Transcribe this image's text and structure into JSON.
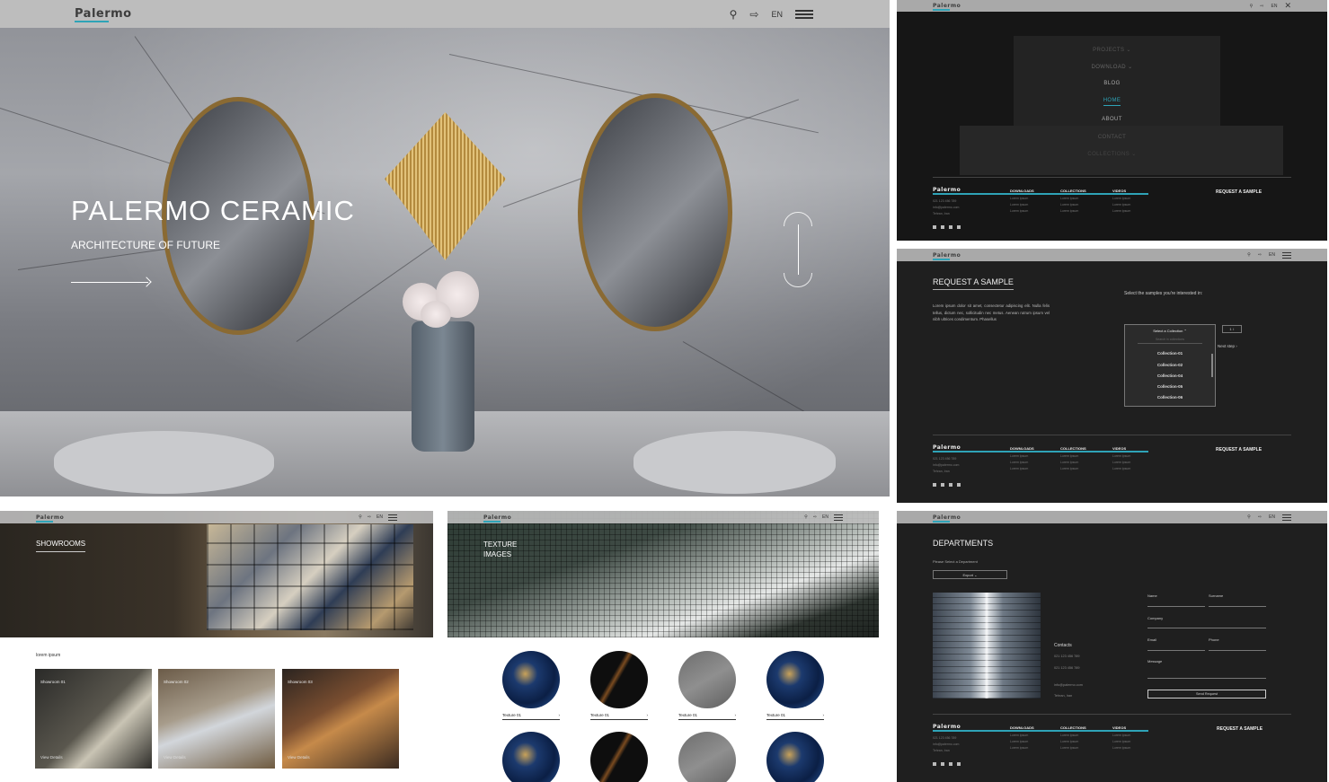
{
  "brand": {
    "logo": "Palermo",
    "accent": "#2ea3b7"
  },
  "hero": {
    "lang": "EN",
    "title": "PALERMO CERAMIC",
    "subtitle": "ARCHITECTURE OF FUTURE"
  },
  "menu": {
    "lang": "EN",
    "items": [
      "PROJECTS",
      "DOWNLOAD",
      "BLOG",
      "HOME",
      "ABOUT",
      "CONTACT",
      "COLLECTIONS"
    ],
    "active": "HOME"
  },
  "footer": {
    "logo": "Palermo",
    "contact": [
      "021 123 456 789",
      "info@palermo.com",
      "Tehran, Iran"
    ],
    "col1": {
      "title": "DOWNLOADS",
      "links": [
        "Lorem ipsum",
        "Lorem ipsum",
        "Lorem ipsum"
      ]
    },
    "col2": {
      "title": "COLLECTIONS",
      "links": [
        "Lorem ipsum",
        "Lorem ipsum",
        "Lorem ipsum"
      ]
    },
    "col3": {
      "title": "VIDEOS",
      "links": [
        "Lorem ipsum",
        "Lorem ipsum",
        "Lorem ipsum"
      ]
    },
    "cta": "REQUEST A SAMPLE"
  },
  "sample": {
    "lang": "EN",
    "title": "REQUEST A SAMPLE",
    "body": "Lorem ipsum dolor sit amet, consectetur adipiscing elit. Nulla felis tellus, dictum nec, sollicitudin nec metus. Aenean rutrum ipsum vel nibh ultrices condimentum. Phasellus",
    "prompt": "Select the samples you're interested in:",
    "dropdown_label": "Select a Collection",
    "search_placeholder": "Search in collections",
    "options": [
      "Collection-01",
      "Collection-02",
      "Collection-04",
      "Collection-05",
      "Collection-06"
    ],
    "qty": "1",
    "next": "Next step"
  },
  "showrooms": {
    "lang": "EN",
    "title": "SHOWROOMS",
    "section_label": "lorem ipsum",
    "cards": [
      {
        "title": "Showroom 01",
        "link": "View Details"
      },
      {
        "title": "Showroom 02",
        "link": "View Details"
      },
      {
        "title": "Showroom 03",
        "link": "View Details"
      }
    ]
  },
  "textures": {
    "lang": "EN",
    "title_line1": "TEXTURE",
    "title_line2": "IMAGES",
    "items": [
      {
        "label": "Texture 01",
        "color": "#1c3a6e"
      },
      {
        "label": "Texture 01",
        "color": "#0e0e0e"
      },
      {
        "label": "Texture 01",
        "color": "#7a7a7a"
      },
      {
        "label": "Texture 01",
        "color": "#1c3a6e"
      }
    ]
  },
  "departments": {
    "lang": "EN",
    "title": "DEPARTMENTS",
    "prompt": "Please Select a Department",
    "select_value": "Export",
    "contacts_title": "Contacts",
    "contacts": [
      "021 123 456 789",
      "021 123 456 789",
      "info@palermo.com",
      "Tehran, Iran"
    ],
    "fields": {
      "name": "Name",
      "surname": "Surname",
      "company": "Company",
      "email": "Email",
      "phone": "Phone",
      "message": "Message"
    },
    "submit": "Send Request"
  }
}
